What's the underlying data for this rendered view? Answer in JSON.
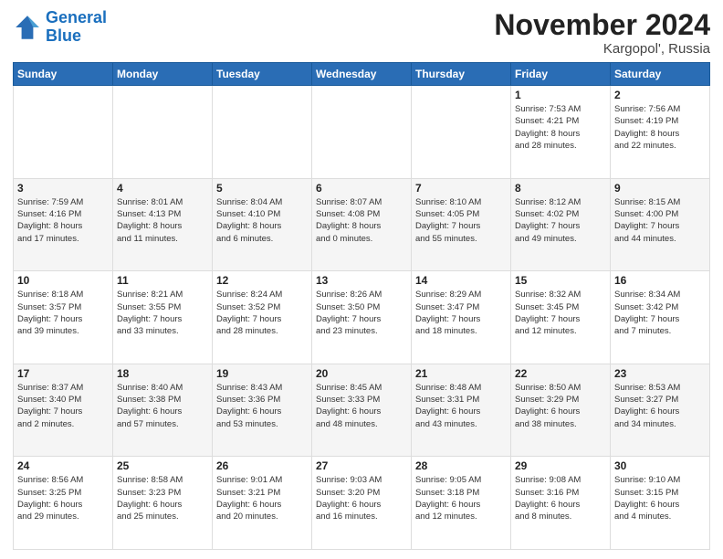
{
  "logo": {
    "line1": "General",
    "line2": "Blue"
  },
  "title": "November 2024",
  "subtitle": "Kargopol', Russia",
  "weekdays": [
    "Sunday",
    "Monday",
    "Tuesday",
    "Wednesday",
    "Thursday",
    "Friday",
    "Saturday"
  ],
  "weeks": [
    [
      {
        "day": "",
        "info": ""
      },
      {
        "day": "",
        "info": ""
      },
      {
        "day": "",
        "info": ""
      },
      {
        "day": "",
        "info": ""
      },
      {
        "day": "",
        "info": ""
      },
      {
        "day": "1",
        "info": "Sunrise: 7:53 AM\nSunset: 4:21 PM\nDaylight: 8 hours\nand 28 minutes."
      },
      {
        "day": "2",
        "info": "Sunrise: 7:56 AM\nSunset: 4:19 PM\nDaylight: 8 hours\nand 22 minutes."
      }
    ],
    [
      {
        "day": "3",
        "info": "Sunrise: 7:59 AM\nSunset: 4:16 PM\nDaylight: 8 hours\nand 17 minutes."
      },
      {
        "day": "4",
        "info": "Sunrise: 8:01 AM\nSunset: 4:13 PM\nDaylight: 8 hours\nand 11 minutes."
      },
      {
        "day": "5",
        "info": "Sunrise: 8:04 AM\nSunset: 4:10 PM\nDaylight: 8 hours\nand 6 minutes."
      },
      {
        "day": "6",
        "info": "Sunrise: 8:07 AM\nSunset: 4:08 PM\nDaylight: 8 hours\nand 0 minutes."
      },
      {
        "day": "7",
        "info": "Sunrise: 8:10 AM\nSunset: 4:05 PM\nDaylight: 7 hours\nand 55 minutes."
      },
      {
        "day": "8",
        "info": "Sunrise: 8:12 AM\nSunset: 4:02 PM\nDaylight: 7 hours\nand 49 minutes."
      },
      {
        "day": "9",
        "info": "Sunrise: 8:15 AM\nSunset: 4:00 PM\nDaylight: 7 hours\nand 44 minutes."
      }
    ],
    [
      {
        "day": "10",
        "info": "Sunrise: 8:18 AM\nSunset: 3:57 PM\nDaylight: 7 hours\nand 39 minutes."
      },
      {
        "day": "11",
        "info": "Sunrise: 8:21 AM\nSunset: 3:55 PM\nDaylight: 7 hours\nand 33 minutes."
      },
      {
        "day": "12",
        "info": "Sunrise: 8:24 AM\nSunset: 3:52 PM\nDaylight: 7 hours\nand 28 minutes."
      },
      {
        "day": "13",
        "info": "Sunrise: 8:26 AM\nSunset: 3:50 PM\nDaylight: 7 hours\nand 23 minutes."
      },
      {
        "day": "14",
        "info": "Sunrise: 8:29 AM\nSunset: 3:47 PM\nDaylight: 7 hours\nand 18 minutes."
      },
      {
        "day": "15",
        "info": "Sunrise: 8:32 AM\nSunset: 3:45 PM\nDaylight: 7 hours\nand 12 minutes."
      },
      {
        "day": "16",
        "info": "Sunrise: 8:34 AM\nSunset: 3:42 PM\nDaylight: 7 hours\nand 7 minutes."
      }
    ],
    [
      {
        "day": "17",
        "info": "Sunrise: 8:37 AM\nSunset: 3:40 PM\nDaylight: 7 hours\nand 2 minutes."
      },
      {
        "day": "18",
        "info": "Sunrise: 8:40 AM\nSunset: 3:38 PM\nDaylight: 6 hours\nand 57 minutes."
      },
      {
        "day": "19",
        "info": "Sunrise: 8:43 AM\nSunset: 3:36 PM\nDaylight: 6 hours\nand 53 minutes."
      },
      {
        "day": "20",
        "info": "Sunrise: 8:45 AM\nSunset: 3:33 PM\nDaylight: 6 hours\nand 48 minutes."
      },
      {
        "day": "21",
        "info": "Sunrise: 8:48 AM\nSunset: 3:31 PM\nDaylight: 6 hours\nand 43 minutes."
      },
      {
        "day": "22",
        "info": "Sunrise: 8:50 AM\nSunset: 3:29 PM\nDaylight: 6 hours\nand 38 minutes."
      },
      {
        "day": "23",
        "info": "Sunrise: 8:53 AM\nSunset: 3:27 PM\nDaylight: 6 hours\nand 34 minutes."
      }
    ],
    [
      {
        "day": "24",
        "info": "Sunrise: 8:56 AM\nSunset: 3:25 PM\nDaylight: 6 hours\nand 29 minutes."
      },
      {
        "day": "25",
        "info": "Sunrise: 8:58 AM\nSunset: 3:23 PM\nDaylight: 6 hours\nand 25 minutes."
      },
      {
        "day": "26",
        "info": "Sunrise: 9:01 AM\nSunset: 3:21 PM\nDaylight: 6 hours\nand 20 minutes."
      },
      {
        "day": "27",
        "info": "Sunrise: 9:03 AM\nSunset: 3:20 PM\nDaylight: 6 hours\nand 16 minutes."
      },
      {
        "day": "28",
        "info": "Sunrise: 9:05 AM\nSunset: 3:18 PM\nDaylight: 6 hours\nand 12 minutes."
      },
      {
        "day": "29",
        "info": "Sunrise: 9:08 AM\nSunset: 3:16 PM\nDaylight: 6 hours\nand 8 minutes."
      },
      {
        "day": "30",
        "info": "Sunrise: 9:10 AM\nSunset: 3:15 PM\nDaylight: 6 hours\nand 4 minutes."
      }
    ]
  ]
}
